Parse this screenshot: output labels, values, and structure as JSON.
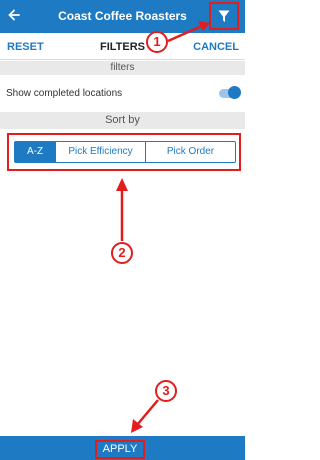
{
  "header": {
    "title": "Coast Coffee Roasters",
    "back_icon": "arrow-left-icon",
    "filter_icon": "funnel-icon"
  },
  "actions": {
    "reset": "RESET",
    "title": "FILTERS",
    "cancel": "CANCEL"
  },
  "filters_section": {
    "label": "filters"
  },
  "toggle": {
    "label": "Show completed locations",
    "on": true
  },
  "sort_section": {
    "label": "Sort by",
    "options": [
      "A-Z",
      "Pick Efficiency",
      "Pick Order"
    ],
    "selected": "A-Z"
  },
  "footer": {
    "apply": "APPLY"
  },
  "callouts": [
    "1",
    "2",
    "3"
  ],
  "colors": {
    "primary": "#1f7ac4",
    "annotation": "#e21d1d"
  }
}
